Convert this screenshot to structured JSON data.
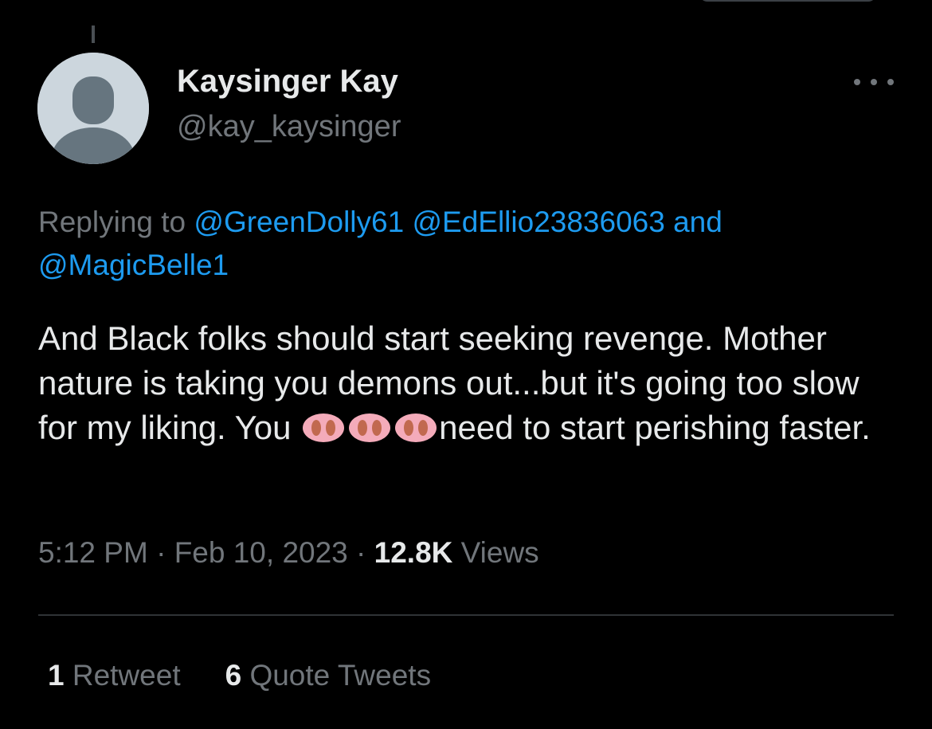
{
  "tweet": {
    "author": {
      "name": "Kaysinger Kay",
      "handle": "@kay_kaysinger",
      "avatar": "default-profile-icon"
    },
    "more_icon": "more-horizontal-icon",
    "replying": {
      "prefix": "Replying to ",
      "mentions": [
        "@GreenDolly61",
        "@EdEllio23836063",
        "@MagicBelle1"
      ],
      "conjunction": "and"
    },
    "text": {
      "part1": "And Black folks should start seeking revenge. Mother nature is taking you demons out...but it's going too slow for my liking. You ",
      "emoji": [
        "pig-nose-emoji",
        "pig-nose-emoji",
        "pig-nose-emoji"
      ],
      "part2": "need to start perishing faster."
    },
    "meta": {
      "time": "5:12 PM",
      "separator": "·",
      "date": "Feb 10, 2023",
      "views_count": "12.8K",
      "views_label": "Views"
    },
    "stats": {
      "retweets_count": "1",
      "retweets_label": "Retweet",
      "quotes_count": "6",
      "quotes_label": "Quote Tweets"
    }
  },
  "colors": {
    "background": "#000000",
    "text_primary": "#e7e9ea",
    "text_secondary": "#71767b",
    "accent": "#1d9bf0",
    "divider": "#2f3336",
    "emoji_pink": "#f4abba",
    "emoji_nostril": "#c1694f"
  }
}
